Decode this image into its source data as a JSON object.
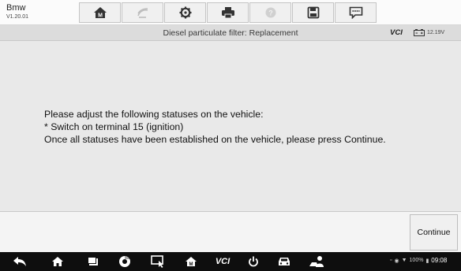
{
  "app": {
    "name": "Bmw",
    "version": "V1.20.01"
  },
  "toolbar": {
    "buttons": [
      {
        "icon": "home-icon"
      },
      {
        "icon": "vehicle-swap-icon"
      },
      {
        "icon": "gear-icon"
      },
      {
        "icon": "print-icon"
      },
      {
        "icon": "help-icon"
      },
      {
        "icon": "save-icon"
      },
      {
        "icon": "data-logging-icon"
      }
    ]
  },
  "header": {
    "title": "Diesel particulate filter: Replacement",
    "vci_label": "VCI",
    "voltage": "12.19V"
  },
  "message": {
    "lines": [
      "Please adjust the following statuses on the vehicle:",
      "* Switch on terminal 15 (ignition)",
      "Once all statuses have been established on the vehicle, please press Continue."
    ]
  },
  "actions": {
    "continue_label": "Continue"
  },
  "navbar": {
    "icons": [
      "back-icon",
      "home-icon",
      "recent-apps-icon",
      "browser-icon",
      "screenshot-icon",
      "shop-home-icon",
      "vci-icon",
      "power-icon",
      "car-icon",
      "mechanic-icon"
    ],
    "vci_text": "VCI",
    "battery": "100%",
    "time": "09:08"
  },
  "colors": {
    "toolbar_bg": "#fbfbfb",
    "subbar_bg": "#dcdcdc",
    "content_bg": "#e9e9e9",
    "navbar_bg": "#0e0e0e"
  }
}
